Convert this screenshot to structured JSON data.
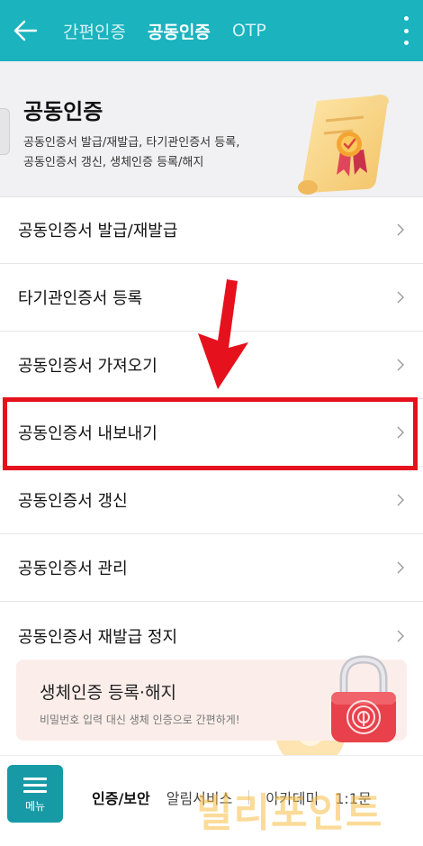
{
  "header": {
    "tabs": [
      {
        "label": "간편인증",
        "active": false
      },
      {
        "label": "공동인증",
        "active": true
      },
      {
        "label": "OTP",
        "active": false
      }
    ],
    "back_icon": "arrow-left-icon",
    "more_icon": "more-vertical-icon"
  },
  "hero": {
    "title": "공동인증",
    "description_line1": "공동인증서 발급/재발급, 타기관인증서 등록,",
    "description_line2": "공동인증서 갱신, 생체인증 등록/해지",
    "illustration": "certificate-scroll-icon"
  },
  "menu": {
    "items": [
      {
        "label": "공동인증서 발급/재발급"
      },
      {
        "label": "타기관인증서 등록"
      },
      {
        "label": "공동인증서 가져오기"
      },
      {
        "label": "공동인증서 내보내기"
      },
      {
        "label": "공동인증서 갱신"
      },
      {
        "label": "공동인증서 관리"
      },
      {
        "label": "공동인증서 재발급 정지"
      }
    ],
    "highlighted_item": 3
  },
  "bio_banner": {
    "title": "생체인증 등록·해지",
    "description": "비밀번호 입력 대신 생체 인증으로 간편하게!",
    "illustration": "fingerprint-lock-icon"
  },
  "bottom_nav": {
    "menu_button_label": "메뉴",
    "tabs": [
      {
        "label": "인증/보안",
        "active": true
      },
      {
        "label": "알림서비스",
        "active": false
      },
      {
        "label": "아카데미",
        "active": false
      },
      {
        "label": "1:1문",
        "active": false
      }
    ]
  },
  "watermark": {
    "text": "빌리포인트"
  },
  "colors": {
    "header_bg": "#1ab3be",
    "highlight_border": "#e5111c",
    "arrow": "#e5111c",
    "menu_button_bg": "#179aa6",
    "banner_bg": "#fbeeea"
  }
}
